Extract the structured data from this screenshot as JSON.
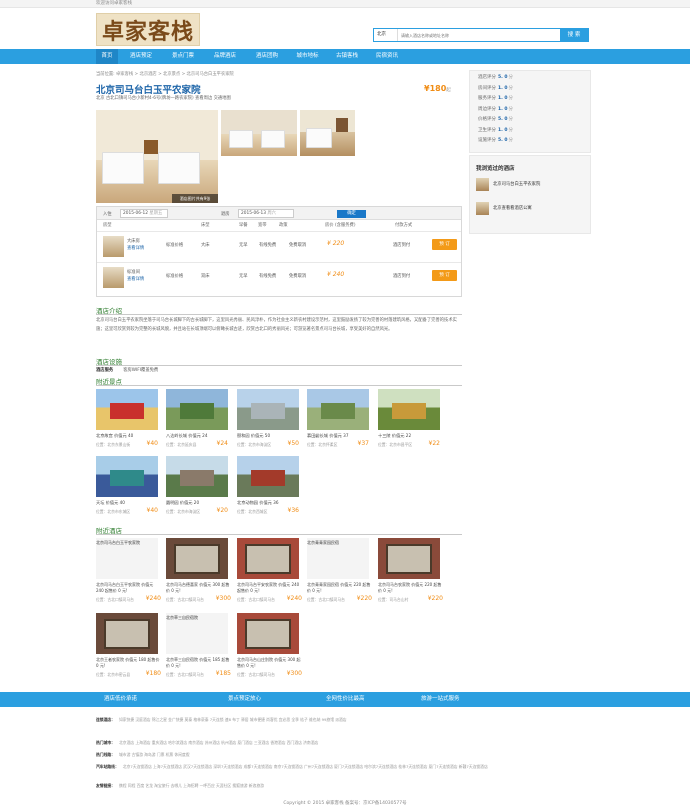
{
  "topbar": {
    "welcome": "欢迎访问卓家客栈"
  },
  "logo": {
    "text": "卓家客栈"
  },
  "search": {
    "select": "北京",
    "placeholder": "请输入酒店名称或地址名称",
    "button": "搜 索"
  },
  "nav": {
    "items": [
      "首页",
      "酒店预定",
      "景点门票",
      "品牌酒店",
      "酒店团购",
      "城市地标",
      "古镇客栈",
      "民宿资讯"
    ],
    "active": 0
  },
  "breadcrumb": "当前位置: 卓家客栈 > 北京酒店 > 北京景点 > 北京司马台白玉平农家院",
  "hotel": {
    "name": "北京司马台白玉平农家院",
    "price": "¥180",
    "price_unit": "起",
    "address": "北京 古北口镇司马台小新村4-6号(牌坊一路农家院)  查看周边  交通地图",
    "photo_caption": "酒店图片共有9张"
  },
  "booking": {
    "checkin_label": "入住",
    "checkin": "2015-06-12",
    "checkin_day": "星期五",
    "checkout_label": "退房",
    "checkout": "2015-06-13",
    "checkout_day": "周六",
    "confirm": "确定",
    "headers": [
      "房型",
      "床型",
      "早餐",
      "宽带",
      "政策",
      "房价 (含服务费)",
      "付款方式"
    ],
    "rooms": [
      {
        "name": "大床房",
        "detail": "查看详情",
        "category": "标准价格",
        "bed": "大床",
        "breakfast": "无早",
        "wifi": "有线免费",
        "policy": "免费取消",
        "price": "¥ 220",
        "pay": "酒店到付",
        "btn": "预 订"
      },
      {
        "name": "标准间",
        "detail": "查看详情",
        "category": "标准价格",
        "bed": "双床",
        "breakfast": "无早",
        "wifi": "有线免费",
        "policy": "免费取消",
        "price": "¥ 240",
        "pay": "酒店到付",
        "btn": "预 订"
      }
    ]
  },
  "intro": {
    "title": "酒店介绍",
    "text": "北京司马台白玉平农家院坐落于司马台长城脚下的古长城脚下，这里风光秀丽、民风淳朴，作为社会主义新农村建设示范村，这里鼓励发扬了较为完善的村落建筑风格，又配备了完善的技术实施；这里可欣赏到较为完整的长城风貌，并且站在长城顶端可以俯瞰长城古迹，欣赏古北口的秀丽风光；可游览著名景点司马台长城，享受美好的自然风光。"
  },
  "facilities": {
    "title": "酒店设施",
    "label": "酒店服务",
    "value": "客房WIFI覆盖免费"
  },
  "attractions": {
    "title": "附近景点",
    "items": [
      {
        "name": "北京故宫 价值元 40",
        "info": "位置：北京东景山街",
        "price": "¥40"
      },
      {
        "name": "八达岭长城 价值元 24",
        "info": "位置：北京延庆县",
        "price": "¥24"
      },
      {
        "name": "颐和园 价值元 50",
        "info": "位置：北京市海淀区",
        "price": "¥50"
      },
      {
        "name": "慕田峪长城 价值元 37",
        "info": "位置：北京怀柔区",
        "price": "¥37"
      },
      {
        "name": "十三陵 价值元 22",
        "info": "位置：北京市昌平区",
        "price": "¥22"
      },
      {
        "name": "天坛 价值元 40",
        "info": "位置：北京市东城区",
        "price": "¥40"
      },
      {
        "name": "圆明园 价值元 20",
        "info": "位置：北京市海淀区",
        "price": "¥20"
      },
      {
        "name": "北京动物园 价值元 36",
        "info": "位置：北京西城区",
        "price": "¥36"
      }
    ]
  },
  "nearby": {
    "title": "附近酒店",
    "items": [
      {
        "name": "北京司马台白玉平农家院 价值元 240 起售价 0 元!",
        "info": "位置：古北口镇司马台",
        "price": "¥240",
        "photo": "北京司马台白玉平农家院"
      },
      {
        "name": "北京司马台德喜家 价值元 300 起售价 0 元!",
        "info": "位置：古北口镇司马台",
        "price": "¥300",
        "photo": ""
      },
      {
        "name": "北京司马台平安农家院 价值元 240 起售价 0 元!",
        "info": "位置：古北口镇司马台",
        "price": "¥240",
        "photo": ""
      },
      {
        "name": "北京青青家园民宿 价值元 220 起售价 0 元!",
        "info": "位置：古北口镇司马台",
        "price": "¥220",
        "photo": "北京青青家园民宿"
      },
      {
        "name": "北京司马台农家院 价值元 220 起售价 0 元!",
        "info": "位置：司马台山村",
        "price": "¥220",
        "photo": ""
      },
      {
        "name": "北京王者农家院 价值元 180 起售价 0 元!",
        "info": "位置：北京市密云县",
        "price": "¥180",
        "photo": ""
      },
      {
        "name": "北京草三自民宿院 价值元 185 起售价 0 元!",
        "info": "位置：古北口镇司马台",
        "price": "¥185",
        "photo": "北京草三自民宿院"
      },
      {
        "name": "北京司马台山庄别院 价值元 300 起售价 0 元!",
        "info": "位置：古北口镇司马台",
        "price": "¥300",
        "photo": ""
      }
    ]
  },
  "sidebar": {
    "scores": [
      {
        "label": "酒店评分",
        "value": "5. 0",
        "unit": "分"
      },
      {
        "label": "房间评分",
        "value": "1. 0",
        "unit": "分"
      },
      {
        "label": "服务评分",
        "value": "1. 0",
        "unit": "分"
      },
      {
        "label": "周边评分",
        "value": "1. 0",
        "unit": "分"
      },
      {
        "label": "价格评分",
        "value": "5. 0",
        "unit": "分"
      },
      {
        "label": "卫生评分",
        "value": "1. 0",
        "unit": "分"
      },
      {
        "label": "设施评分",
        "value": "5. 0",
        "unit": "分"
      }
    ],
    "recent_title": "我浏览过的酒店",
    "recent": [
      "北京司马台白玉平农家院",
      "北京查看看酒店公寓"
    ]
  },
  "footer_bar": [
    "酒店低价承诺",
    "景点预定放心",
    "全网性价比最高",
    "旅游一站式服务"
  ],
  "footer_links": [
    {
      "label": "连锁酒店：",
      "text": "如家快捷  汉庭酒店  锦江之星  金广快捷  莫泰  格林豪泰  7天连锁  速8  布丁  驿居  城市便捷  尚客优  宜必思  全季  桔子  维也纳  99旅馆  派酒店"
    },
    {
      "label": "热门城市：",
      "text": "北京酒店  上海酒店  重庆酒店  哈尔滨酒店  南京酒店  苏州酒店  杭州酒店  厦门酒店  三亚酒店  香港酒店  西门酒店  济南酒店"
    },
    {
      "label": "热门线路：",
      "text": "城市游  古镇游  海岛游  门票  机票  休闲度假"
    },
    {
      "label": "汽车站路线：",
      "text": "北京7天连锁酒店  上海7天连锁酒店  武汉7天连锁酒店  深圳7天连锁酒店  成都7天连锁酒店  南京7天连锁酒店  广州7天连锁酒店  厦门7天连锁酒店  哈尔滨7天连锁酒店  桂林7天连锁酒店  厦门7天连锁酒店  新疆7天连锁酒店"
    },
    {
      "label": "友情链接：",
      "text": "携程  同程  百度  艺龙  淘宝旅行  去哪儿  上海招聘  一呼百应  天涯社区  搜狐旅游  新浪旅游"
    }
  ],
  "copyright": "Copyright © 2015 卓家客栈  备案号：京ICP备14030577号"
}
